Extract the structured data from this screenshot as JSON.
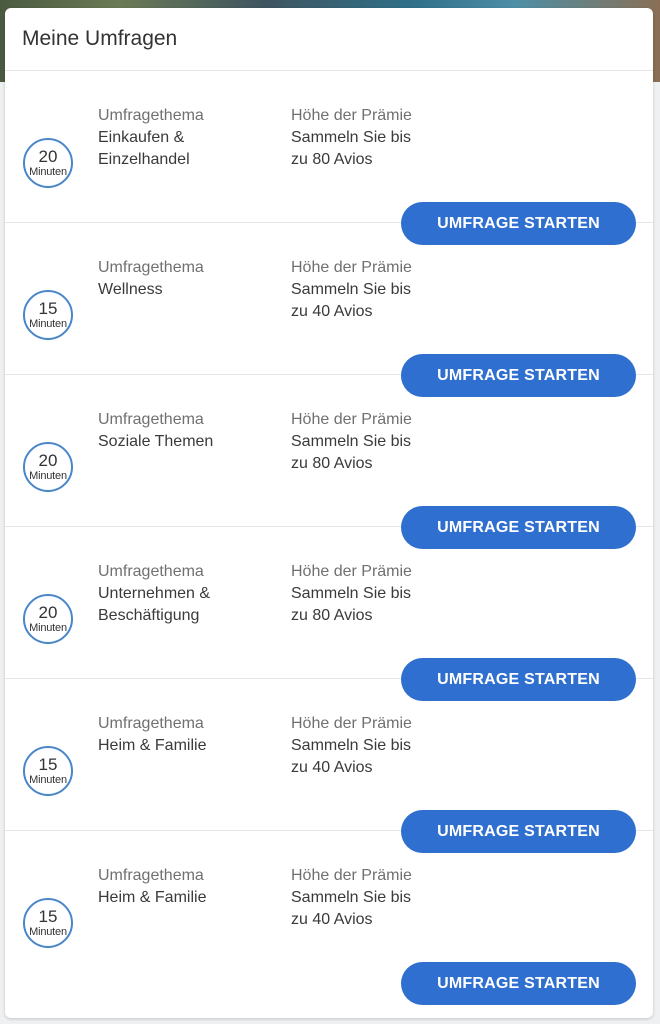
{
  "header": {
    "title": "Meine Umfragen"
  },
  "surveys": [
    {
      "duration": "20",
      "duration_unit": "Minuten",
      "topic_label": "Umfragethema",
      "topic": "Einkaufen & Einzelhandel",
      "reward_label": "Höhe der Prämie",
      "reward": "Sammeln Sie bis zu 80 Avios",
      "button_label": "UMFRAGE STARTEN"
    },
    {
      "duration": "15",
      "duration_unit": "Minuten",
      "topic_label": "Umfragethema",
      "topic": "Wellness",
      "reward_label": "Höhe der Prämie",
      "reward": "Sammeln Sie bis zu 40 Avios",
      "button_label": "UMFRAGE STARTEN"
    },
    {
      "duration": "20",
      "duration_unit": "Minuten",
      "topic_label": "Umfragethema",
      "topic": "Soziale Themen",
      "reward_label": "Höhe der Prämie",
      "reward": "Sammeln Sie bis zu 80 Avios",
      "button_label": "UMFRAGE STARTEN"
    },
    {
      "duration": "20",
      "duration_unit": "Minuten",
      "topic_label": "Umfragethema",
      "topic": "Unternehmen & Beschäftigung",
      "reward_label": "Höhe der Prämie",
      "reward": "Sammeln Sie bis zu 80 Avios",
      "button_label": "UMFRAGE STARTEN"
    },
    {
      "duration": "15",
      "duration_unit": "Minuten",
      "topic_label": "Umfragethema",
      "topic": "Heim & Familie",
      "reward_label": "Höhe der Prämie",
      "reward": "Sammeln Sie bis zu 40 Avios",
      "button_label": "UMFRAGE STARTEN"
    },
    {
      "duration": "15",
      "duration_unit": "Minuten",
      "topic_label": "Umfragethema",
      "topic": "Heim & Familie",
      "reward_label": "Höhe der Prämie",
      "reward": "Sammeln Sie bis zu 40 Avios",
      "button_label": "UMFRAGE STARTEN"
    }
  ],
  "colors": {
    "accent": "#2f6fd0",
    "circle_border": "#4a86c8",
    "label_text": "#707070",
    "body_text": "#3a3a3a"
  }
}
